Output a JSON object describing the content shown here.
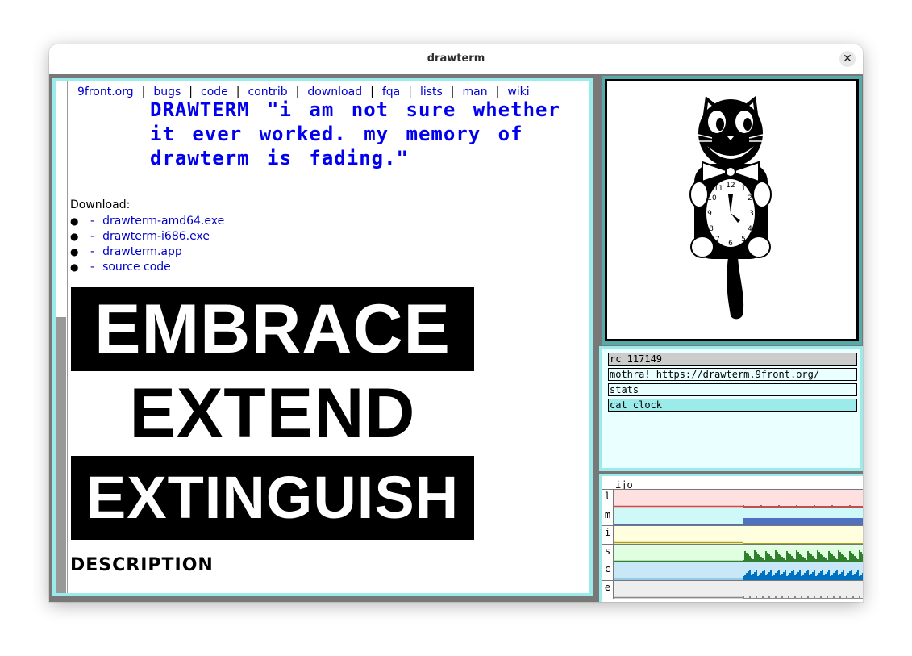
{
  "window": {
    "title": "drawterm",
    "close_symbol": "✕"
  },
  "browser": {
    "nav": [
      {
        "label": "9front.org"
      },
      {
        "label": "bugs"
      },
      {
        "label": "code"
      },
      {
        "label": "contrib"
      },
      {
        "label": "download"
      },
      {
        "label": "fqa"
      },
      {
        "label": "lists"
      },
      {
        "label": "man"
      },
      {
        "label": "wiki"
      }
    ],
    "nav_separator": "|",
    "headline": "DRAWTERM \"i am not sure whether it ever worked. my memory of drawterm is fading.\"",
    "download_label": "Download:",
    "downloads": [
      {
        "label": "drawterm-amd64.exe"
      },
      {
        "label": "drawterm-i686.exe"
      },
      {
        "label": "drawterm.app"
      },
      {
        "label": "source code"
      }
    ],
    "bullet": "●",
    "dash": "-",
    "banner": [
      "EMBRACE",
      "EXTEND",
      "EXTINGUISH"
    ],
    "section_heading": "DESCRIPTION"
  },
  "clock": {
    "numerals": [
      "12",
      "1",
      "2",
      "3",
      "4",
      "5",
      "6",
      "7",
      "8",
      "9",
      "10",
      "11"
    ]
  },
  "windows_list": [
    {
      "label": "rc 117149"
    },
    {
      "label": "mothra! https://drawterm.9front.org/"
    },
    {
      "label": "stats"
    },
    {
      "label": "cat clock"
    }
  ],
  "stats": {
    "title": "ijo",
    "rows": [
      {
        "label": "l",
        "bg": "#ffe0e0",
        "color": "#c05050"
      },
      {
        "label": "m",
        "bg": "#cff8f8",
        "color": "#5070c0"
      },
      {
        "label": "i",
        "bg": "#ffffe0",
        "color": "#b0a020"
      },
      {
        "label": "s",
        "bg": "#e0ffe0",
        "color": "#308030"
      },
      {
        "label": "c",
        "bg": "#c8e8f8",
        "color": "#0070c0"
      },
      {
        "label": "e",
        "bg": "#eeeeee",
        "color": "#888888"
      }
    ]
  }
}
